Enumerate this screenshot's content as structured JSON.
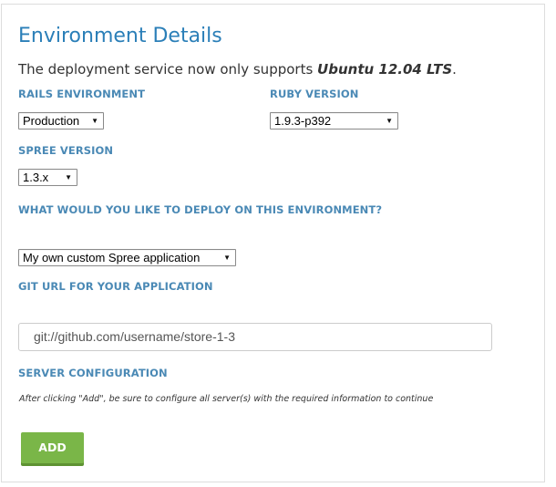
{
  "title": "Environment Details",
  "intro": {
    "prefix": "The deployment service now only supports ",
    "emphasis": "Ubuntu 12.04 LTS",
    "suffix": "."
  },
  "rails_environment": {
    "label": "RAILS ENVIRONMENT",
    "value": "Production"
  },
  "ruby_version": {
    "label": "RUBY VERSION",
    "value": "1.9.3-p392"
  },
  "spree_version": {
    "label": "SPREE VERSION",
    "value": "1.3.x"
  },
  "deploy_target": {
    "label": "WHAT WOULD YOU LIKE TO DEPLOY ON THIS ENVIRONMENT?",
    "value": "My own custom Spree application"
  },
  "git_url": {
    "label": "GIT URL FOR YOUR APPLICATION",
    "value": "git://github.com/username/store-1-3"
  },
  "server_configuration": {
    "label": "SERVER CONFIGURATION",
    "help": "After clicking \"Add\", be sure to configure all server(s) with the required information to continue"
  },
  "add_button": {
    "label": "ADD"
  },
  "colors": {
    "title": "#2b7fb8",
    "label": "#4a89b5",
    "button": "#7ab648",
    "button_shadow": "#5e9232"
  },
  "icons": {
    "dropdown": "triangle-down-icon"
  }
}
